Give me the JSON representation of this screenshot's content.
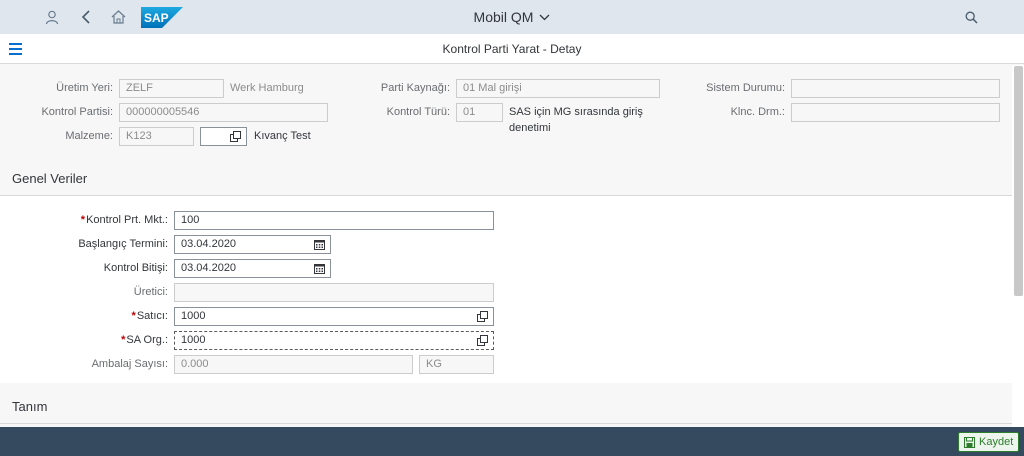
{
  "shell": {
    "app_title": "Mobil QM",
    "logo_text": "SAP"
  },
  "subheader": {
    "page_title": "Kontrol Parti Yarat - Detay"
  },
  "header_fields": {
    "uretim_yeri": {
      "label": "Üretim Yeri:",
      "value": "ZELF",
      "description": "Werk Hamburg"
    },
    "kontrol_partisi": {
      "label": "Kontrol Partisi:",
      "value": "000000005546"
    },
    "malzeme": {
      "label": "Malzeme:",
      "value": "K123",
      "description": "Kıvanç Test"
    },
    "parti_kaynagi": {
      "label": "Parti Kaynağı:",
      "value": "01 Mal girişi"
    },
    "kontrol_turu": {
      "label": "Kontrol Türü:",
      "value": "01",
      "description_line1": "SAS için MG sırasında giriş",
      "description_line2": "denetimi"
    },
    "sistem_durumu": {
      "label": "Sistem Durumu:",
      "value": ""
    },
    "klnc_drm": {
      "label": "Klnc. Drm.:",
      "value": ""
    }
  },
  "genel_veriler": {
    "title": "Genel Veriler",
    "kontrol_prt_mkt": {
      "label": "Kontrol Prt. Mkt.:",
      "value": "100"
    },
    "baslangic_termini": {
      "label": "Başlangıç Termini:",
      "value": "03.04.2020"
    },
    "kontrol_bitisi": {
      "label": "Kontrol Bitişi:",
      "value": "03.04.2020"
    },
    "uretici": {
      "label": "Üretici:",
      "value": ""
    },
    "satici": {
      "label": "Satıcı:",
      "value": "1000"
    },
    "sa_org": {
      "label": "SA Org.:",
      "value": "1000"
    },
    "ambalaj_sayisi": {
      "label": "Ambalaj Sayısı:",
      "value": "0.000",
      "unit": "KG"
    }
  },
  "tanim": {
    "title": "Tanım"
  },
  "footer": {
    "save_label": "Kaydet"
  },
  "colors": {
    "shell_bg": "#dfe6ee",
    "footer_bg": "#354a5f",
    "accent": "#0a6ed1",
    "required": "#bb0000",
    "save_green": "#2b7d2b"
  }
}
